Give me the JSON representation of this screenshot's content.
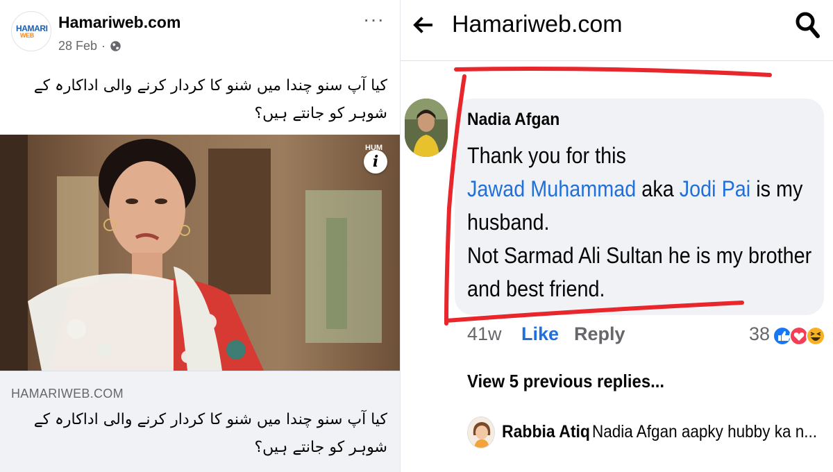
{
  "post": {
    "page_name": "Hamariweb.com",
    "date": "28 Feb",
    "separator": "·",
    "logo_text_1": "HAMARI",
    "logo_text_2": "WEB",
    "text": "کیا آپ سنو چندا میں شنو کا کردار کرنے والی اداکارہ کے شوہر کو جانتے ہیں؟",
    "image_watermark": "HUM",
    "info_glyph": "i",
    "link_domain": "HAMARIWEB.COM",
    "link_title": "کیا آپ سنو چندا میں شنو کا کردار کرنے والی اداکارہ کے شوہر کو جانتے ہیں؟",
    "more_glyph": "···"
  },
  "comments_view": {
    "title": "Hamariweb.com",
    "comment": {
      "author": "Nadia Afgan",
      "line1": "Thank you for this",
      "mention1": "Jawad Muhammad",
      "aka": " aka ",
      "mention2": "Jodi Pai",
      "line2_end": " is my",
      "line3": "husband.",
      "line4": "Not Sarmad Ali Sultan he is my brother",
      "line5": "and best friend.",
      "time": "41w",
      "like_label": "Like",
      "reply_label": "Reply",
      "reaction_count": "38"
    },
    "view_previous": "View 5 previous replies...",
    "reply": {
      "author": "Rabbia Atiq",
      "text": "Nadia Afgan aapky hubby ka n..."
    }
  },
  "colors": {
    "facebook_blue": "#216fdb",
    "secondary_text": "#65676b",
    "bubble_bg": "#f0f2f5",
    "annotation_red": "#e8262b"
  },
  "icons": [
    "globe-icon",
    "more-icon",
    "info-icon",
    "back-arrow-icon",
    "search-icon",
    "like-reaction-icon",
    "love-reaction-icon",
    "haha-reaction-icon"
  ]
}
